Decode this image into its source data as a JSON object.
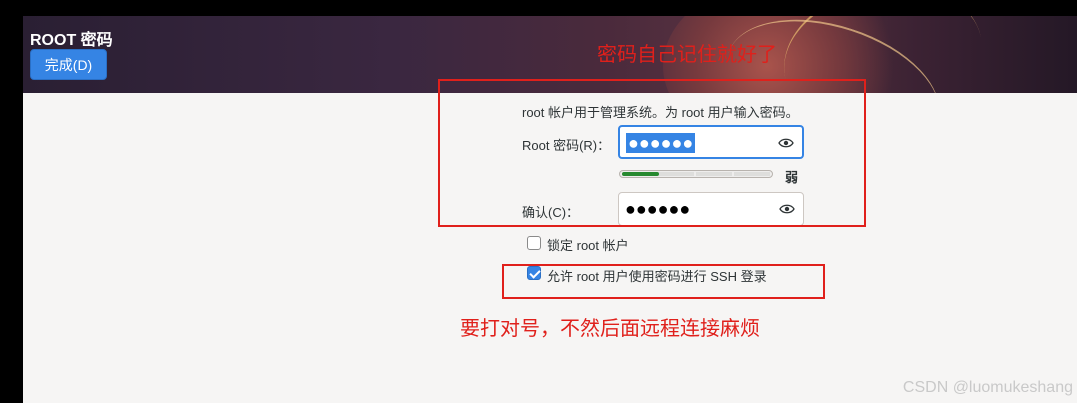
{
  "header": {
    "title": "ROOT 密码",
    "done_label": "完成(D)"
  },
  "form": {
    "description": "root 帐户用于管理系统。为 root 用户输入密码。",
    "password_label": "Root 密码(R)：",
    "password_value": "●●●●●●",
    "strength": {
      "level_fraction": 0.25,
      "label": "弱",
      "color": "#26892f"
    },
    "confirm_label": "确认(C)：",
    "confirm_value": "●●●●●●",
    "lock_root_label": "锁定 root 帐户",
    "lock_root_checked": false,
    "allow_ssh_label": "允许 root 用户使用密码进行 SSH 登录",
    "allow_ssh_checked": true
  },
  "annotations": {
    "top_note": "密码自己记住就好了",
    "bottom_note": "要打对号，不然后面远程连接麻烦",
    "color": "#e0201b"
  },
  "watermark": "CSDN @luomukeshang",
  "colors": {
    "accent": "#3584e4",
    "background": "#f6f5f4"
  }
}
